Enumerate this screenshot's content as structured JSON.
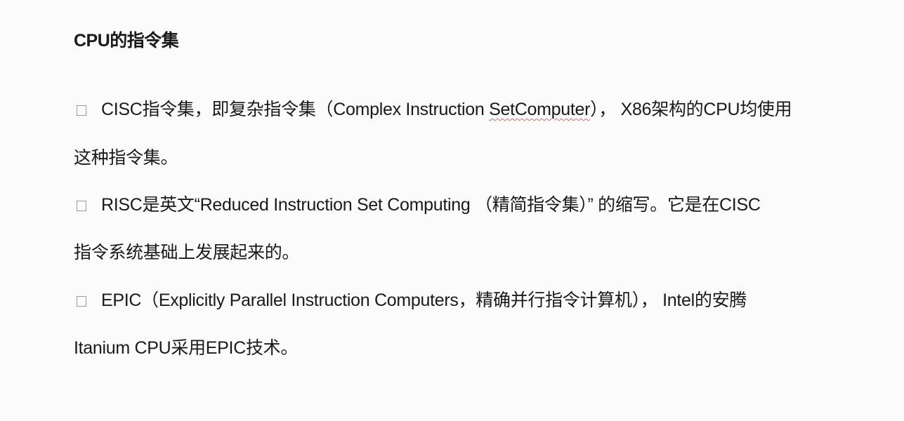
{
  "document": {
    "heading": "CPU的指令集",
    "items": [
      {
        "line1_pre": "CISC指令集，即复杂指令集（Complex Instruction ",
        "line1_mark": "SetComputer",
        "line1_post": "），  X86架构的CPU均使用",
        "line2": "这种指令集。"
      },
      {
        "line1": "RISC是英文“Reduced Instruction Set Computing （精简指令集）” 的缩写。它是在CISC",
        "line2": "指令系统基础上发展起来的。"
      },
      {
        "line1": "EPIC（Explicitly Parallel Instruction Computers，精确并行指令计算机），  Intel的安腾",
        "line2": "Itanium CPU采用EPIC技术。"
      }
    ]
  }
}
